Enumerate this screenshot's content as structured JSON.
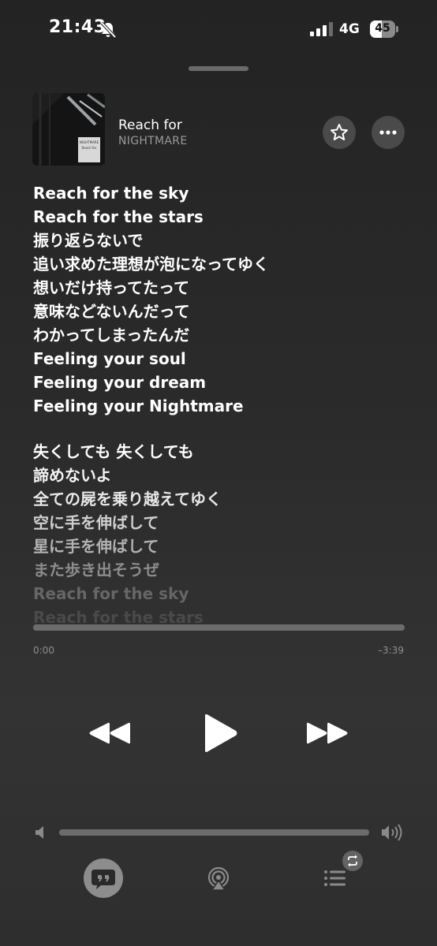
{
  "status_bar": {
    "time": "21:43",
    "network": "4G",
    "battery": "45",
    "icons": [
      "bell-slash-icon",
      "signal-icon",
      "battery-icon"
    ]
  },
  "now_playing": {
    "song_title": "Reach for",
    "artist": "NIGHTMARE",
    "album_art_text": [
      "NIGHTMARE",
      "Reach for"
    ],
    "icons": [
      "star-icon",
      "ellipsis-icon"
    ]
  },
  "lyrics": [
    "Reach for the sky",
    "Reach for the stars",
    "振り返らないで",
    "追い求めた理想が泡になってゆく",
    "想いだけ持ってたって",
    "意味などないんだって",
    "わかってしまったんだ",
    "Feeling your soul",
    "Feeling your dream",
    "Feeling your Nightmare",
    "",
    "失くしても 失くしても",
    "諦めないよ",
    "全ての屍を乗り越えてゆく",
    "空に手を伸ばして",
    "星に手を伸ばして",
    "また歩き出そうぜ",
    "Reach for the sky",
    "Reach for the stars"
  ],
  "progress": {
    "elapsed": "0:00",
    "remaining": "–3:39",
    "fraction": 1.0
  },
  "controls": {
    "icons": [
      "rewind-icon",
      "play-icon",
      "fast-forward-icon"
    ]
  },
  "volume": {
    "level": 1.0,
    "icons": [
      "speaker-low-icon",
      "speaker-high-icon"
    ]
  },
  "bottom_bar": {
    "icons": [
      "lyrics-quote-icon",
      "airplay-audio-icon",
      "queue-list-icon",
      "repeat-icon"
    ]
  }
}
